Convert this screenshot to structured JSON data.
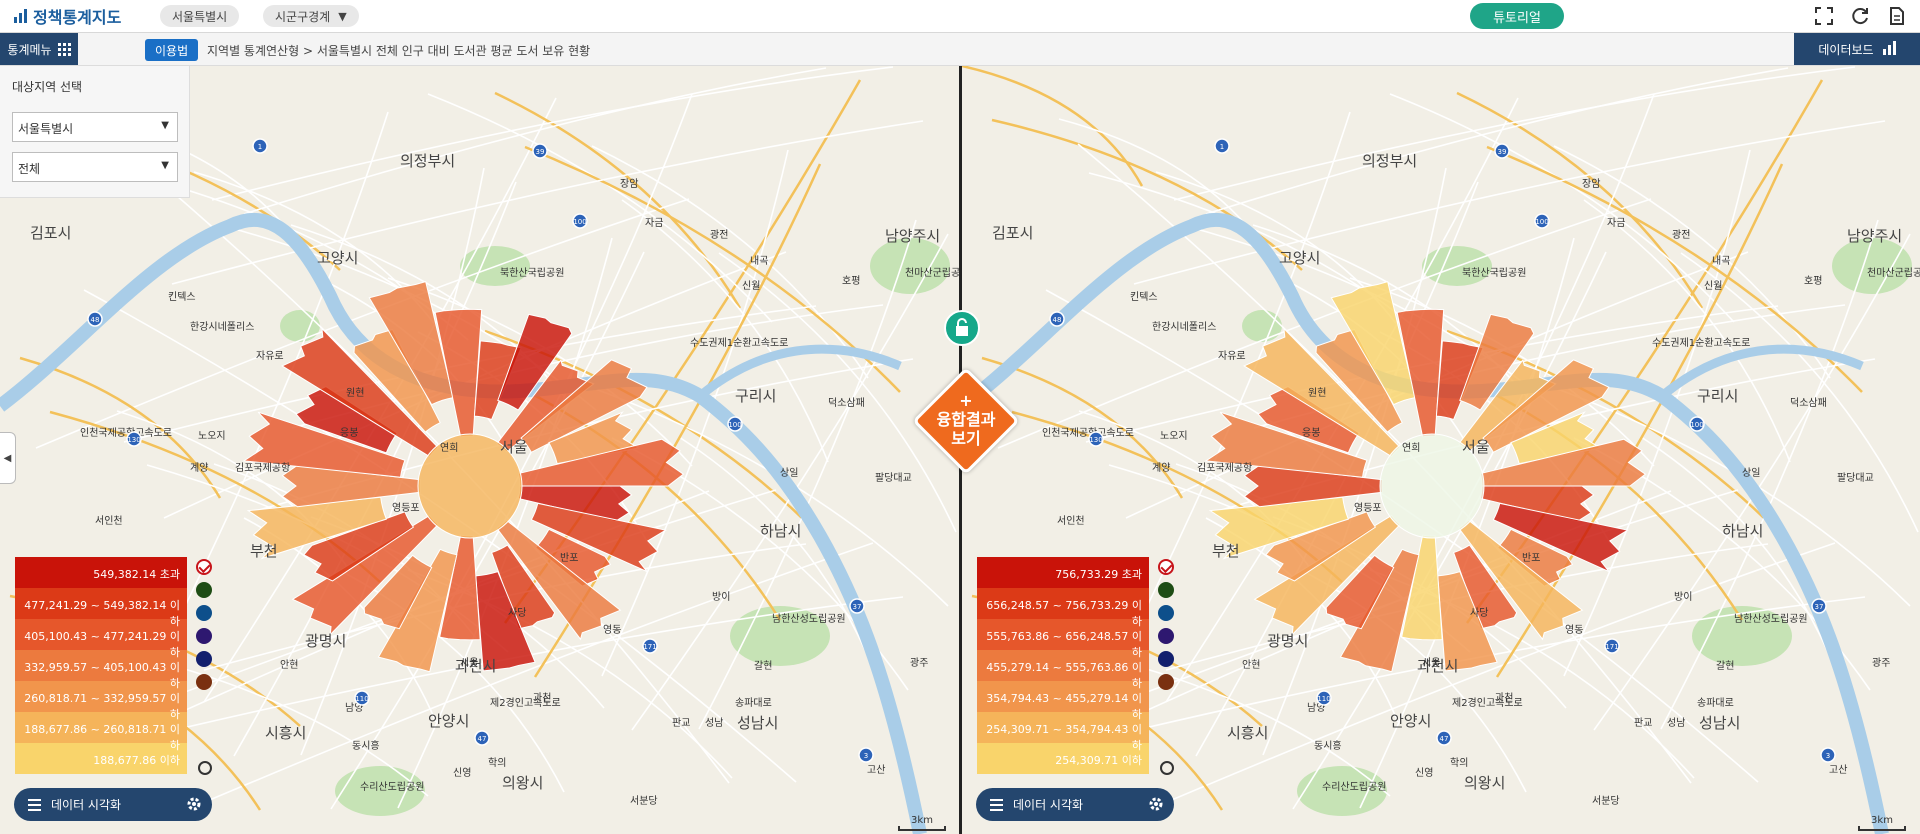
{
  "app": {
    "title": "정책통계지도",
    "region_pill": "서울특별시",
    "boundary_pill": "시군구경계",
    "tutorial_label": "튜토리얼"
  },
  "subbar": {
    "menu_label": "통계메뉴",
    "usage_label": "이용법",
    "breadcrumb": "지역별 통계연산형 > 서울특별시 전체 인구 대비 도서관 평균 도서 보유 현황",
    "dashboard_label": "데이터보드"
  },
  "region_panel": {
    "title": "대상지역 선택",
    "sido": "서울특별시",
    "sigungu": "전체"
  },
  "colors": {
    "navy": "#24466e",
    "accent_blue": "#1a6fc6",
    "teal": "#1fa588",
    "fusion_orange": "#ef6a1e",
    "legend": [
      "#c91309",
      "#dc3a17",
      "#e6572b",
      "#ec7a3e",
      "#f1954c",
      "#f5b45a",
      "#f9d46b"
    ],
    "swatch_palettes": [
      "#1e4d15",
      "#0d4f8b",
      "#2e1870",
      "#13206e",
      "#7a3010"
    ]
  },
  "legend_left": [
    "549,382.14 초과",
    "477,241.29 ~ 549,382.14 이하",
    "405,100.43 ~ 477,241.29 이하",
    "332,959.57 ~ 405,100.43 이하",
    "260,818.71 ~ 332,959.57 이하",
    "188,677.86 ~ 260,818.71 이하",
    "188,677.86 이하"
  ],
  "legend_right": [
    "756,733.29 초과",
    "656,248.57 ~ 756,733.29 이하",
    "555,763.86 ~ 656,248.57 이하",
    "455,279.14 ~ 555,763.86 이하",
    "354,794.43 ~ 455,279.14 이하",
    "254,309.71 ~ 354,794.43 이하",
    "254,309.71 이하"
  ],
  "vis_label": "데이터 시각화",
  "fusion": {
    "plus": "+",
    "line1": "융합결과",
    "line2": "보기"
  },
  "scale": "3km",
  "map_labels_left": [
    "의정부시",
    "남양주시",
    "고양시",
    "구리시",
    "하남시",
    "김포시",
    "부천",
    "광명시",
    "과천시",
    "안양시",
    "시흥시",
    "의왕시",
    "성남시",
    "서울",
    "김포국제공항",
    "천마산군립공원",
    "남한산성도립공원",
    "수리산도립공원",
    "킨텍스",
    "한강시네폴리스",
    "자유로",
    "원현",
    "노오지",
    "계양",
    "서인천",
    "장암",
    "자금",
    "광전",
    "내곡",
    "신월",
    "호평",
    "덕소삼패",
    "팔당대교",
    "상일",
    "안현",
    "남양",
    "동시흥",
    "신영",
    "학의",
    "판교",
    "서울",
    "과천",
    "갈현",
    "광주",
    "고산",
    "서분당",
    "성남",
    "북한산국립공원",
    "연희",
    "응봉",
    "반포",
    "방이",
    "영동",
    "사당",
    "영등포",
    "제2경인고속도로",
    "수도권제1순환고속도로",
    "인천국제공항고속도로",
    "송파대로"
  ],
  "map_labels_right": [
    "의정부시",
    "남양주시",
    "고양시",
    "구리시",
    "하남시",
    "김포시",
    "부천",
    "광명시",
    "과천시",
    "안양시",
    "시흥시",
    "의왕시",
    "성남시",
    "서울",
    "김포국제공항",
    "천마산군립공원",
    "남한산성도립공원",
    "수리산도립공원",
    "킨텍스",
    "한강시네폴리스",
    "자유로",
    "원현",
    "노오지",
    "계양",
    "서인천",
    "장암",
    "자금",
    "광전",
    "내곡",
    "신월",
    "호평",
    "덕소삼패",
    "팔당대교",
    "상일",
    "안현",
    "남양",
    "동시흥",
    "신영",
    "학의",
    "판교",
    "서울",
    "과천",
    "갈현",
    "광주",
    "고산",
    "서분당",
    "성남",
    "북한산국립공원",
    "연희",
    "응봉",
    "반포",
    "방이",
    "영동",
    "사당",
    "영등포",
    "제2경인고속도로",
    "수도권제1순환고속도로",
    "인천국제공항고속도로",
    "송파대로"
  ],
  "route_shields": [
    "100",
    "39",
    "1",
    "48",
    "130",
    "110",
    "37",
    "47",
    "3",
    "171",
    "100"
  ]
}
